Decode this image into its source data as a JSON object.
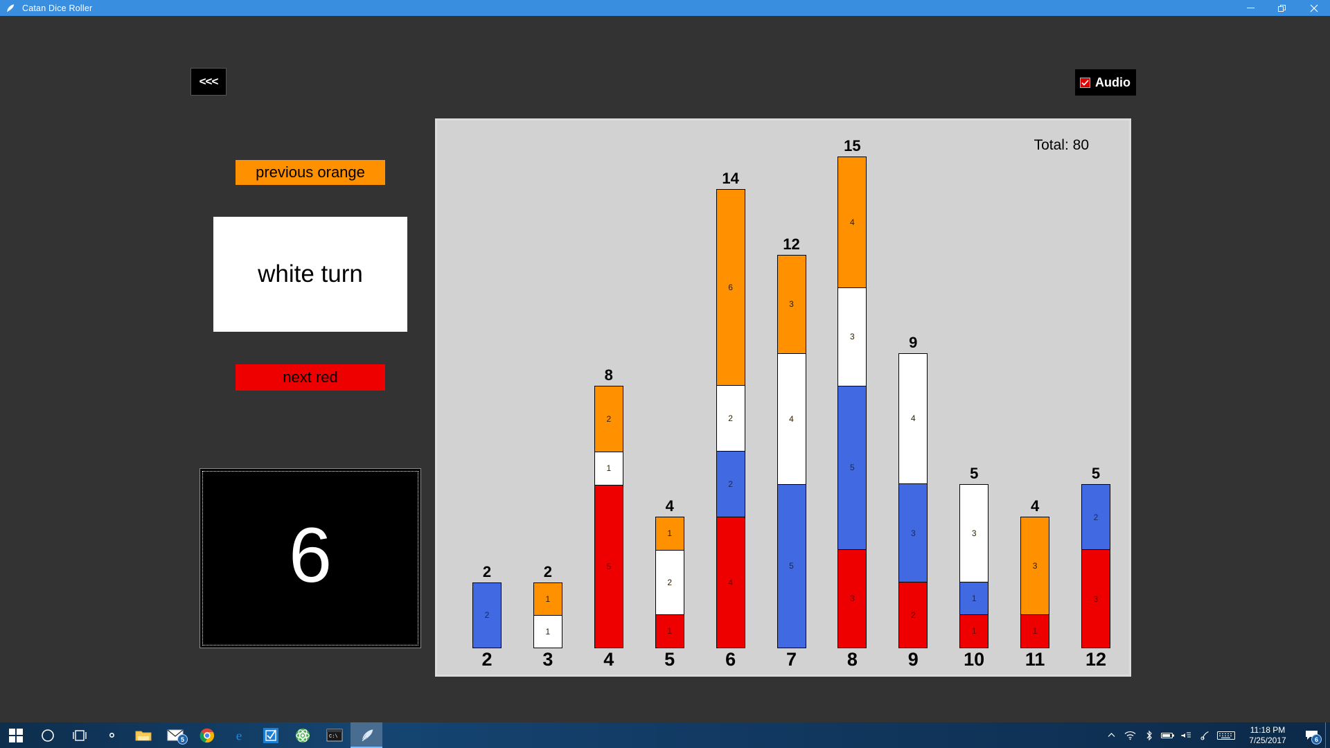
{
  "window": {
    "title": "Catan Dice Roller",
    "icon": "quill-icon",
    "controls": {
      "minimize": "minimize-icon",
      "restore": "restore-icon",
      "close": "close-icon"
    }
  },
  "app": {
    "back_button_label": "<<<",
    "audio": {
      "label": "Audio",
      "checked": true
    },
    "previous_player_button": {
      "label": "previous orange",
      "color": "#ff9000"
    },
    "current_turn": {
      "label": "white turn",
      "color": "#ffffff"
    },
    "next_player_button": {
      "label": "next red",
      "color": "#ee0000"
    },
    "dice": {
      "value": "6"
    }
  },
  "chart_data": {
    "type": "bar",
    "title": "",
    "stacked": true,
    "total_label": "Total: 80",
    "total": 80,
    "xlabel": "",
    "ylabel": "",
    "ylim": [
      0,
      15
    ],
    "grid": false,
    "legend": "none",
    "categories": [
      "2",
      "3",
      "4",
      "5",
      "6",
      "7",
      "8",
      "9",
      "10",
      "11",
      "12"
    ],
    "totals": [
      2,
      2,
      8,
      4,
      14,
      12,
      15,
      9,
      5,
      4,
      5
    ],
    "series": [
      {
        "name": "orange",
        "color": "#ff9000",
        "values": [
          0,
          1,
          2,
          1,
          6,
          3,
          4,
          0,
          0,
          3,
          0
        ]
      },
      {
        "name": "white",
        "color": "#ffffff",
        "values": [
          0,
          1,
          1,
          2,
          2,
          4,
          3,
          4,
          3,
          0,
          0
        ]
      },
      {
        "name": "blue",
        "color": "#4169e1",
        "values": [
          2,
          0,
          0,
          0,
          2,
          5,
          5,
          3,
          1,
          0,
          2
        ]
      },
      {
        "name": "red",
        "color": "#ee0000",
        "values": [
          0,
          0,
          5,
          1,
          4,
          0,
          3,
          2,
          1,
          1,
          3
        ]
      }
    ],
    "bars": [
      {
        "category": "2",
        "total": 2,
        "segments": [
          {
            "color": "#4169e1",
            "value": 2
          }
        ]
      },
      {
        "category": "3",
        "total": 2,
        "segments": [
          {
            "color": "#ff9000",
            "value": 1
          },
          {
            "color": "#ffffff",
            "value": 1
          }
        ]
      },
      {
        "category": "4",
        "total": 8,
        "segments": [
          {
            "color": "#ff9000",
            "value": 2
          },
          {
            "color": "#ffffff",
            "value": 1
          },
          {
            "color": "#ee0000",
            "value": 5
          }
        ]
      },
      {
        "category": "5",
        "total": 4,
        "segments": [
          {
            "color": "#ff9000",
            "value": 1
          },
          {
            "color": "#ffffff",
            "value": 2
          },
          {
            "color": "#ee0000",
            "value": 1
          }
        ]
      },
      {
        "category": "6",
        "total": 14,
        "segments": [
          {
            "color": "#ff9000",
            "value": 6
          },
          {
            "color": "#ffffff",
            "value": 2
          },
          {
            "color": "#4169e1",
            "value": 2
          },
          {
            "color": "#ee0000",
            "value": 4
          }
        ]
      },
      {
        "category": "7",
        "total": 12,
        "segments": [
          {
            "color": "#ff9000",
            "value": 3
          },
          {
            "color": "#ffffff",
            "value": 4
          },
          {
            "color": "#4169e1",
            "value": 5
          }
        ]
      },
      {
        "category": "8",
        "total": 15,
        "segments": [
          {
            "color": "#ff9000",
            "value": 4
          },
          {
            "color": "#ffffff",
            "value": 3
          },
          {
            "color": "#4169e1",
            "value": 5
          },
          {
            "color": "#ee0000",
            "value": 3
          }
        ]
      },
      {
        "category": "9",
        "total": 9,
        "segments": [
          {
            "color": "#ffffff",
            "value": 4
          },
          {
            "color": "#4169e1",
            "value": 3
          },
          {
            "color": "#ee0000",
            "value": 2
          }
        ]
      },
      {
        "category": "10",
        "total": 5,
        "segments": [
          {
            "color": "#ffffff",
            "value": 3
          },
          {
            "color": "#4169e1",
            "value": 1
          },
          {
            "color": "#ee0000",
            "value": 1
          }
        ]
      },
      {
        "category": "11",
        "total": 4,
        "segments": [
          {
            "color": "#ff9000",
            "value": 3
          },
          {
            "color": "#ee0000",
            "value": 1
          }
        ]
      },
      {
        "category": "12",
        "total": 5,
        "segments": [
          {
            "color": "#4169e1",
            "value": 2
          },
          {
            "color": "#ee0000",
            "value": 3
          }
        ]
      }
    ]
  },
  "taskbar": {
    "items": [
      {
        "name": "start-button",
        "icon": "windows-logo-icon",
        "badge": null
      },
      {
        "name": "cortana-search",
        "icon": "circle-icon",
        "badge": null
      },
      {
        "name": "task-view",
        "icon": "task-view-icon",
        "badge": null
      },
      {
        "name": "settings-app",
        "icon": "gear-icon",
        "badge": null
      },
      {
        "name": "file-explorer",
        "icon": "folder-icon",
        "badge": null
      },
      {
        "name": "mail-app",
        "icon": "envelope-icon",
        "badge": "5"
      },
      {
        "name": "chrome-browser",
        "icon": "chrome-icon",
        "badge": null
      },
      {
        "name": "edge-browser",
        "icon": "edge-icon",
        "badge": null
      },
      {
        "name": "tasks-app",
        "icon": "checkbox-square-icon",
        "badge": null
      },
      {
        "name": "atom-editor",
        "icon": "atom-icon",
        "badge": null
      },
      {
        "name": "command-prompt",
        "icon": "terminal-icon",
        "badge": null
      },
      {
        "name": "catan-dice-roller",
        "icon": "quill-icon",
        "badge": null,
        "active": true
      }
    ],
    "tray": {
      "icons": [
        {
          "name": "show-hidden-icons",
          "icon": "chevron-up-icon"
        },
        {
          "name": "network-icon",
          "icon": "wifi-icon"
        },
        {
          "name": "bluetooth-icon",
          "icon": "bluetooth-icon"
        },
        {
          "name": "battery-icon",
          "icon": "battery-icon"
        },
        {
          "name": "volume-icon",
          "icon": "speaker-icon"
        },
        {
          "name": "pen-workspace-icon",
          "icon": "pen-icon"
        },
        {
          "name": "touch-keyboard-icon",
          "icon": "keyboard-icon"
        }
      ],
      "time": "11:18 PM",
      "date": "7/25/2017",
      "notifications_badge": "6"
    }
  }
}
